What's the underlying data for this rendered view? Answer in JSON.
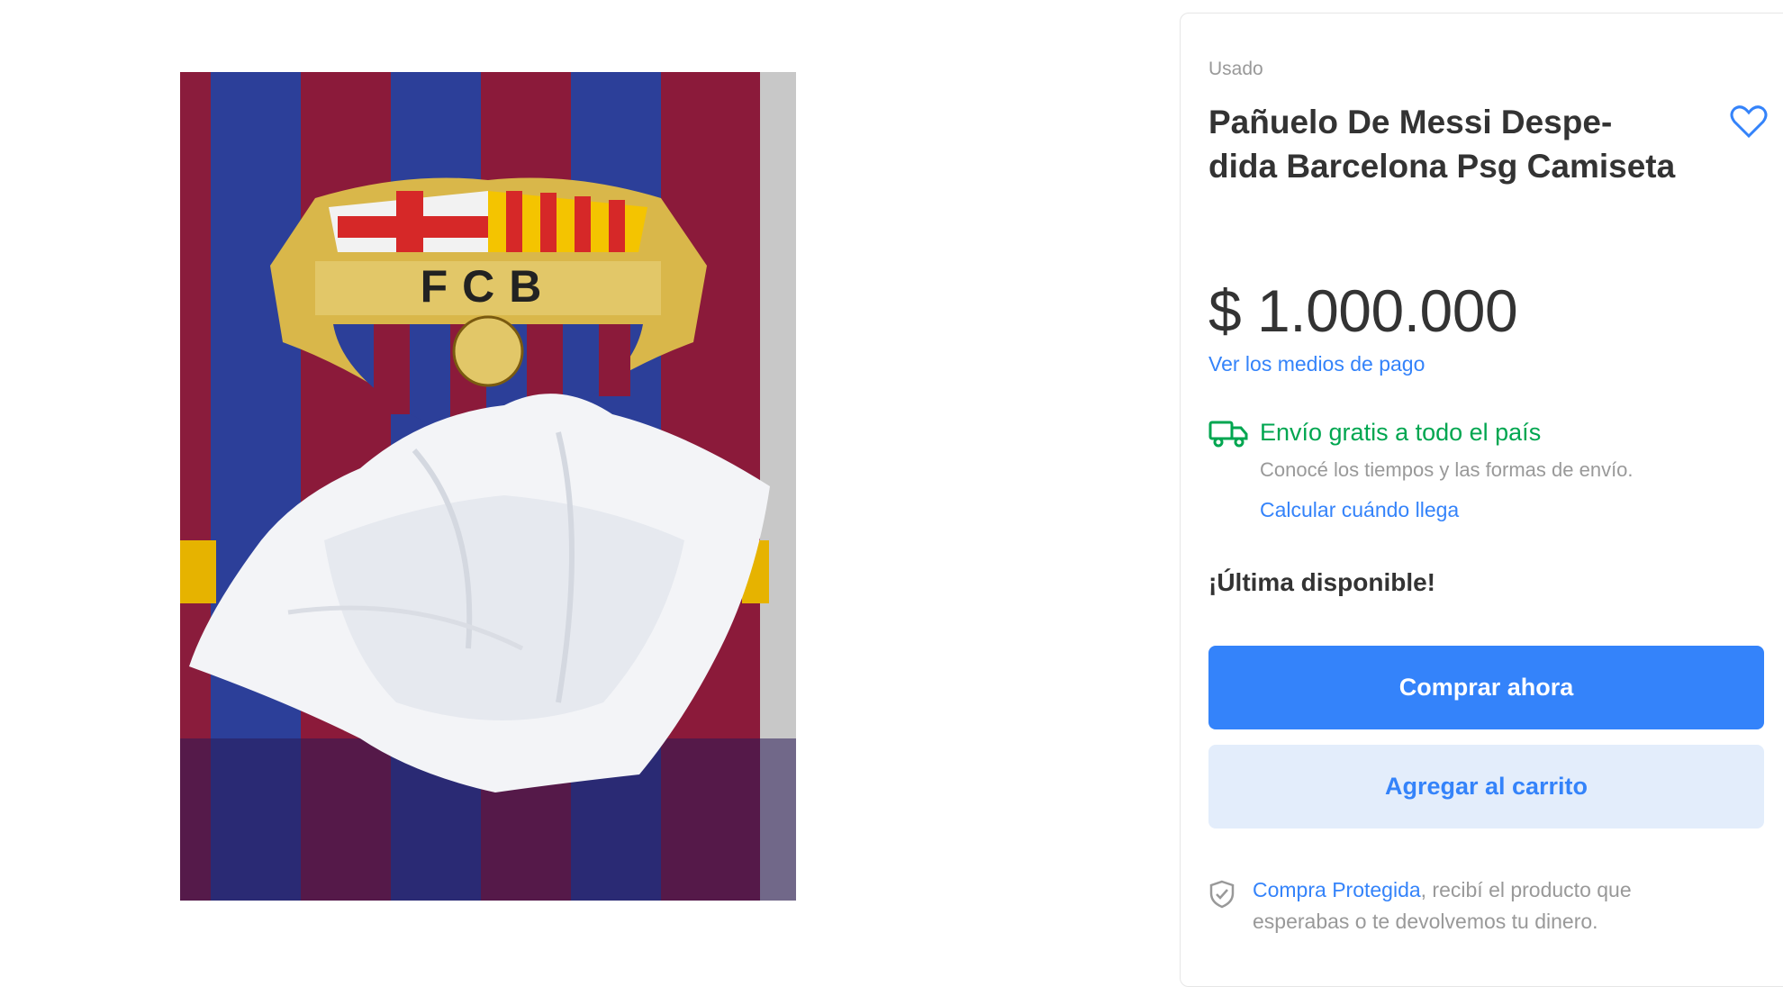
{
  "product": {
    "condition": "Usado",
    "title": "Pañuelo De Messi Despe- dida Barcelona Psg Camiseta",
    "price": "$ 1.000.000",
    "payment_link": "Ver los medios de pago",
    "favorite_icon": "heart-outline-icon"
  },
  "shipping": {
    "icon": "truck-icon",
    "title": "Envío gratis a todo el país",
    "subtitle": "Conocé los tiempos y las formas de envío.",
    "link": "Calcular cuándo llega"
  },
  "stock_label": "¡Última disponible!",
  "actions": {
    "buy_label": "Comprar ahora",
    "cart_label": "Agregar al carrito"
  },
  "protection": {
    "icon": "shield-check-icon",
    "link": "Compra Protegida",
    "text": ", recibí el producto que esperabas o te devolvemos tu dinero."
  },
  "image": {
    "crest_text": "FCB"
  },
  "colors": {
    "accent": "#3483fa",
    "shipping_green": "#00a650",
    "cart_button_bg": "#e3edfb",
    "muted_text": "#999999"
  }
}
